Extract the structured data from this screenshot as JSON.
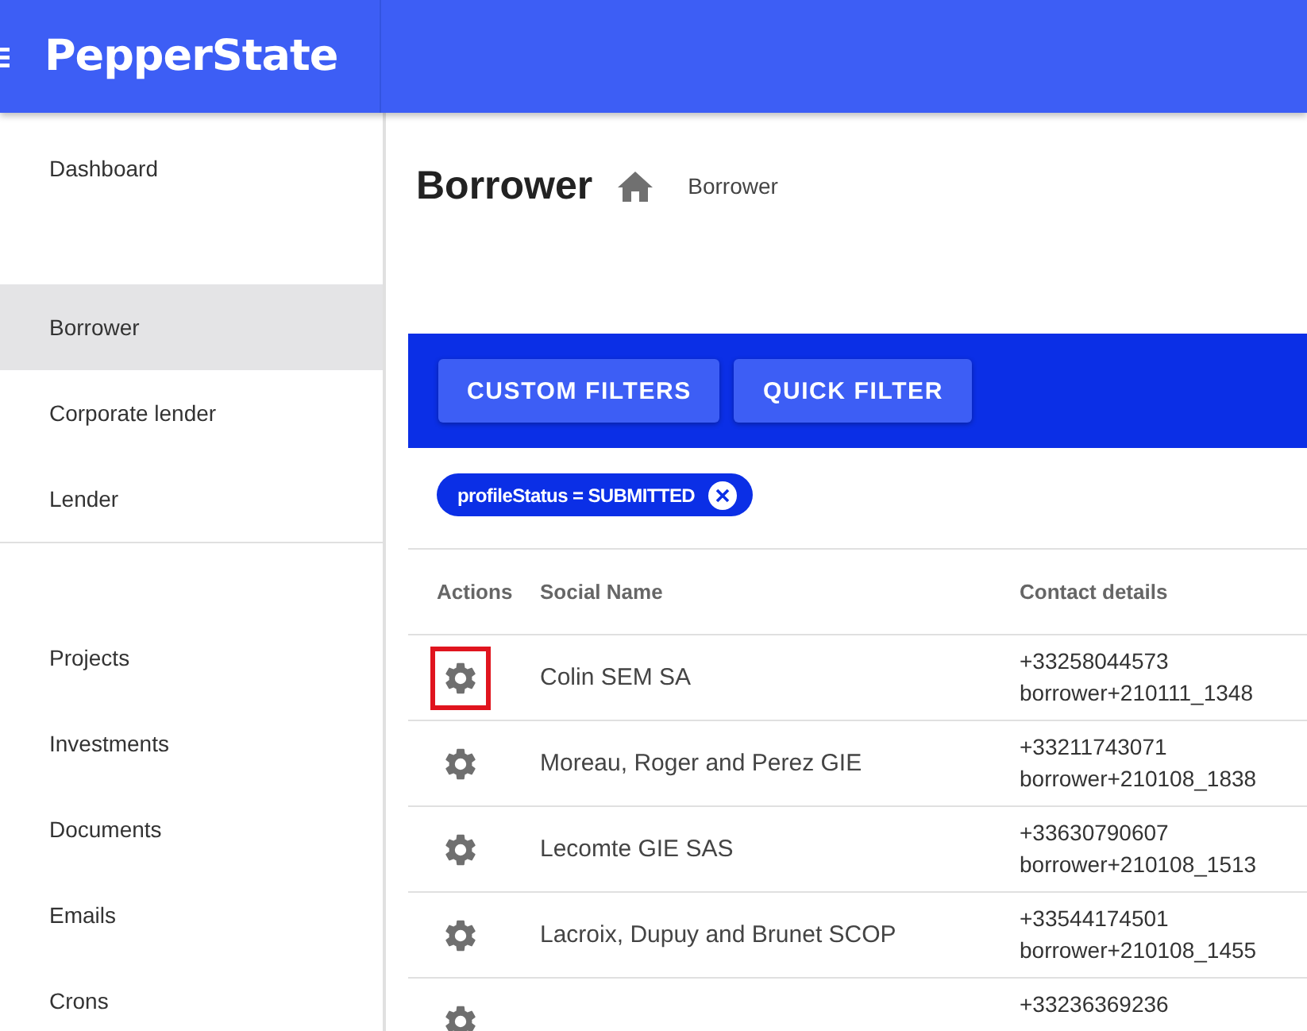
{
  "app": {
    "logo": "PepperState"
  },
  "sidebar": {
    "sections": [
      {
        "items": [
          {
            "label": "Dashboard",
            "selected": false
          }
        ]
      },
      {
        "items": [
          {
            "label": "Borrower",
            "selected": true
          },
          {
            "label": "Corporate lender",
            "selected": false
          },
          {
            "label": "Lender",
            "selected": false
          }
        ]
      },
      {
        "items": [
          {
            "label": "Projects",
            "selected": false
          },
          {
            "label": "Investments",
            "selected": false
          },
          {
            "label": "Documents",
            "selected": false
          },
          {
            "label": "Emails",
            "selected": false
          },
          {
            "label": "Crons",
            "selected": false
          }
        ]
      }
    ]
  },
  "page": {
    "title": "Borrower",
    "breadcrumb": "Borrower"
  },
  "filter_bar": {
    "buttons": [
      "CUSTOM FILTERS",
      "QUICK FILTER"
    ]
  },
  "active_filters": [
    {
      "label": "profileStatus = SUBMITTED"
    }
  ],
  "table": {
    "columns": [
      "Actions",
      "Social Name",
      "Contact details"
    ],
    "rows": [
      {
        "highlighted": true,
        "social_name": "Colin SEM SA",
        "phone": "+33258044573",
        "email": "borrower+210111_1348"
      },
      {
        "highlighted": false,
        "social_name": "Moreau, Roger and Perez GIE",
        "phone": "+33211743071",
        "email": "borrower+210108_1838"
      },
      {
        "highlighted": false,
        "social_name": "Lecomte GIE SAS",
        "phone": "+33630790607",
        "email": "borrower+210108_1513"
      },
      {
        "highlighted": false,
        "social_name": "Lacroix, Dupuy and Brunet SCOP",
        "phone": "+33544174501",
        "email": "borrower+210108_1455"
      },
      {
        "highlighted": false,
        "phone": "+33236369236"
      }
    ]
  }
}
